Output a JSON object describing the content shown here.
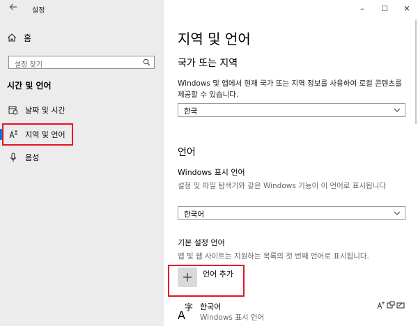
{
  "window": {
    "title": "설정",
    "controls": [
      "–",
      "☐",
      "✕"
    ]
  },
  "sidebar": {
    "home_label": "홈",
    "search_placeholder": "설정 찾기",
    "section_title": "시간 및 언어",
    "items": [
      {
        "label": "날짜 및 시간",
        "icon": "calendar-clock-icon"
      },
      {
        "label": "지역 및 언어",
        "icon": "language-icon",
        "selected": true
      },
      {
        "label": "음성",
        "icon": "microphone-icon"
      }
    ]
  },
  "main": {
    "page_title": "지역 및 언어",
    "region": {
      "heading": "국가 또는 지역",
      "description": "Windows 및 앱에서 현재 국가 또는 지역 정보를 사용하여 로컬 콘텐츠를 제공할 수 있습니다.",
      "selected": "한국"
    },
    "language": {
      "heading": "언어",
      "display_label": "Windows 표시 언어",
      "display_description": "설정 및 파일 탐색기와 같은 Windows 기능이 이 언어로 표시됩니다",
      "display_selected": "한국어",
      "preferred_label": "기본 설정 언어",
      "preferred_description": "앱 및 웹 사이트는 지원하는 목록의 첫 번째 언어로 표시됩니다.",
      "add_label": "언어 추가",
      "installed": [
        {
          "name": "한국어",
          "sub": "Windows 표시 언어"
        }
      ]
    }
  },
  "colors": {
    "accent": "#0078d7",
    "highlight": "#e81123",
    "sidebar_bg": "#ececec"
  }
}
